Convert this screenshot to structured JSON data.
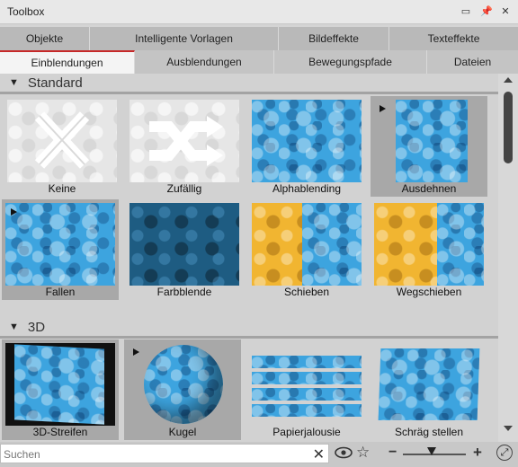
{
  "window": {
    "title": "Toolbox",
    "controls": [
      "minimize-icon",
      "pin-icon",
      "close-icon"
    ]
  },
  "tabs_row1": [
    {
      "label": "Objekte"
    },
    {
      "label": "Intelligente Vorlagen"
    },
    {
      "label": "Bildeffekte"
    },
    {
      "label": "Texteffekte"
    }
  ],
  "tabs_row2": [
    {
      "label": "Einblendungen",
      "active": true
    },
    {
      "label": "Ausblendungen"
    },
    {
      "label": "Bewegungspfade"
    },
    {
      "label": "Dateien"
    }
  ],
  "sections": [
    {
      "title": "Standard",
      "items": [
        "Keine",
        "Zufällig",
        "Alphablending",
        "Ausdehnen",
        "Fallen",
        "Farbblende",
        "Schieben",
        "Wegschieben"
      ]
    },
    {
      "title": "3D",
      "items": [
        "3D-Streifen",
        "Kugel",
        "Papierjalousie",
        "Schräg stellen"
      ]
    }
  ],
  "search": {
    "placeholder": "Suchen",
    "value": ""
  },
  "zoom": {
    "level": 0.45
  },
  "colors": {
    "accent": "#c62828",
    "tile_selected": "#a8a8a8",
    "blue_texture": "#3da4df",
    "yellow_texture": "#f1b531"
  }
}
